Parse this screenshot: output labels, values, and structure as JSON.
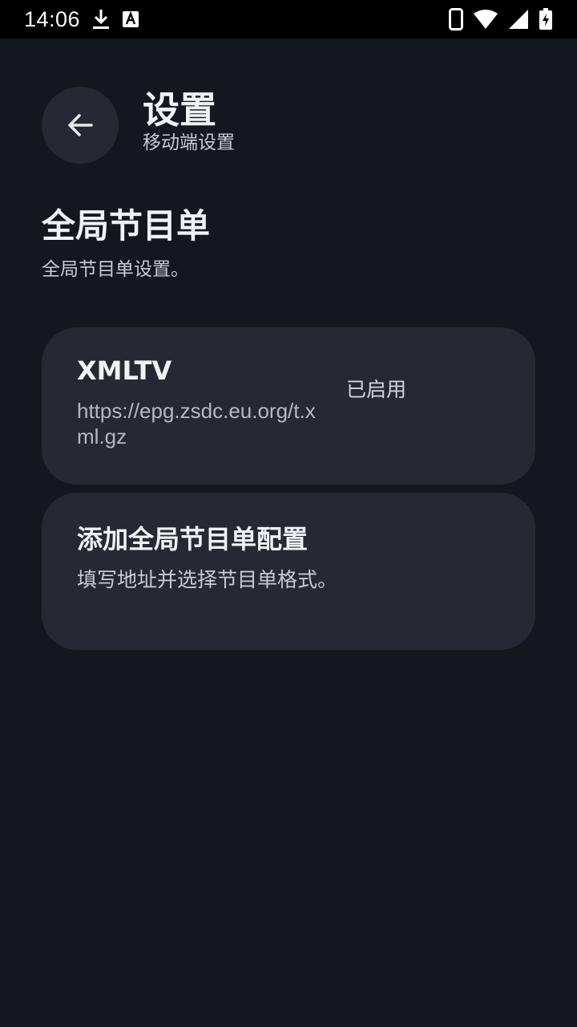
{
  "status_bar": {
    "time": "14:06",
    "icons": [
      "download-icon",
      "keyboard-a-icon",
      "phone-icon",
      "wifi-icon",
      "signal-icon",
      "battery-charging-icon"
    ]
  },
  "header": {
    "title": "设置",
    "subtitle": "移动端设置",
    "back_icon": "arrow-left-icon"
  },
  "section": {
    "title": "全局节目单",
    "description": "全局节目单设置。"
  },
  "epg_sources": [
    {
      "name": "XMLTV",
      "url": "https://epg.zsdc.eu.org/t.xml.gz",
      "status": "已启用"
    }
  ],
  "add_card": {
    "title": "添加全局节目单配置",
    "description": "填写地址并选择节目单格式。"
  },
  "colors": {
    "background": "#15171f",
    "card": "#262833",
    "text_primary": "#f1f2f6",
    "text_secondary": "#c9cad2"
  }
}
